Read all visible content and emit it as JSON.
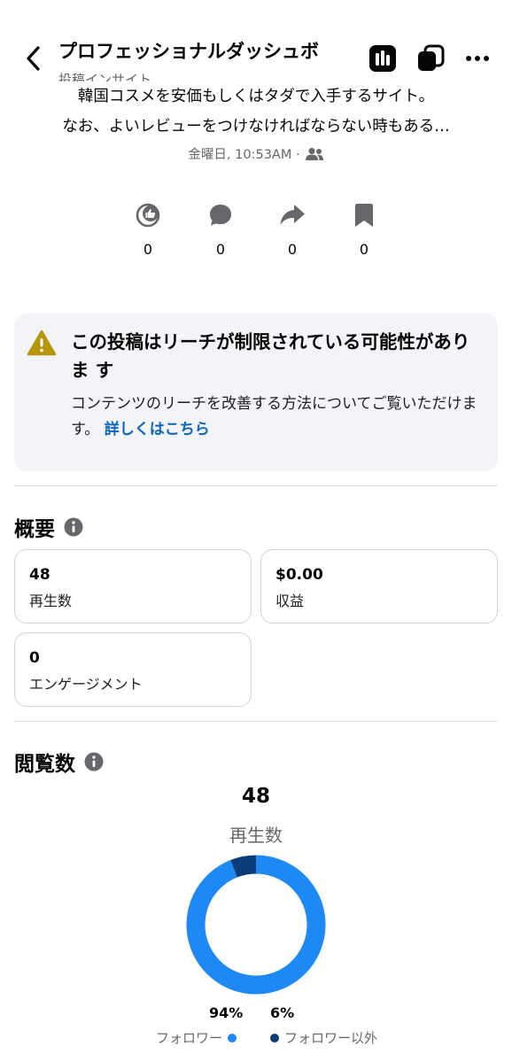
{
  "header": {
    "title": "プロフェッショナルダッシュボ",
    "subtitle": "投稿インサイト"
  },
  "post": {
    "line1": "韓国コスメを安価もしくはタダで入手するサイト。",
    "line2": "なお、よいレビューをつけなければならない時もある…",
    "meta": "金曜日, 10:53AM ·"
  },
  "stats": {
    "reactions": "0",
    "comments": "0",
    "shares": "0",
    "saves": "0"
  },
  "warning": {
    "title": "この投稿はリーチが制限されている可能性がありま す",
    "body": "コンテンツのリーチを改善する方法についてご覧いただけます。",
    "link": "詳しくはこちら"
  },
  "overview": {
    "title": "概要",
    "cards": [
      {
        "value": "48",
        "label": "再生数"
      },
      {
        "value": "$0.00",
        "label": "収益"
      },
      {
        "value": "0",
        "label": "エンゲージメント"
      }
    ]
  },
  "views": {
    "title": "閲覧数",
    "total": "48",
    "label": "再生数"
  },
  "chart_data": {
    "type": "pie",
    "categories": [
      "フォロワー",
      "フォロワー以外"
    ],
    "values": [
      94,
      6
    ],
    "labels": [
      "94%",
      "6%"
    ],
    "colors": [
      "#1e88f5",
      "#0a3d78"
    ],
    "legend_placement": "bottom"
  },
  "colors": {
    "accent": "#1e88f5",
    "dark_series": "#0a3d78",
    "link": "#0a66c2",
    "warning": "#b8960c"
  }
}
